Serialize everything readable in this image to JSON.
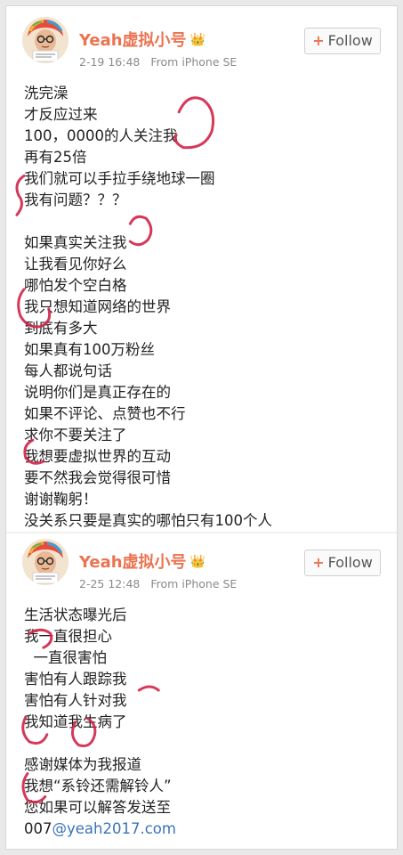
{
  "posts": [
    {
      "username": "Yeah虚拟小号",
      "time": "2-19 16:48",
      "source": "From iPhone SE",
      "follow_label": "Follow",
      "lines": [
        "洗完澡",
        "才反应过来",
        "100，0000的人关注我",
        "再有25倍",
        "我们就可以手拉手绕地球一圈",
        "我有问题？？？",
        "",
        "如果真实关注我",
        "让我看见你好么",
        "哪怕发个空白格",
        "我只想知道网络的世界",
        "到底有多大",
        "如果真有100万粉丝",
        "每人都说句话",
        "说明你们是真正存在的",
        "如果不评论、点赞也不行",
        "求你不要关注了",
        "我想要虚拟世界的互动",
        "要不然我会觉得很可惜",
        "谢谢鞠躬！",
        "没关系只要是真实的哪怕只有100个人"
      ]
    },
    {
      "username": "Yeah虚拟小号",
      "time": "2-25 12:48",
      "source": "From iPhone SE",
      "follow_label": "Follow",
      "lines": [
        "生活状态曝光后",
        "我一直很担心",
        "  一直很害怕",
        "害怕有人跟踪我",
        "害怕有人针对我",
        "我知道我生病了",
        "",
        "感谢媒体为我报道",
        "我想“系铃还需解铃人”",
        "您如果可以解答发送至"
      ],
      "email_prefix": "007",
      "email_rest": "@yeah2017.com"
    }
  ],
  "colors": {
    "username": "#eb7350",
    "meta": "#8a8a8a",
    "link": "#3b73b9",
    "scribble": "#d02448"
  },
  "icons": {
    "badge": "crown-emoji",
    "follow": "plus-icon"
  }
}
